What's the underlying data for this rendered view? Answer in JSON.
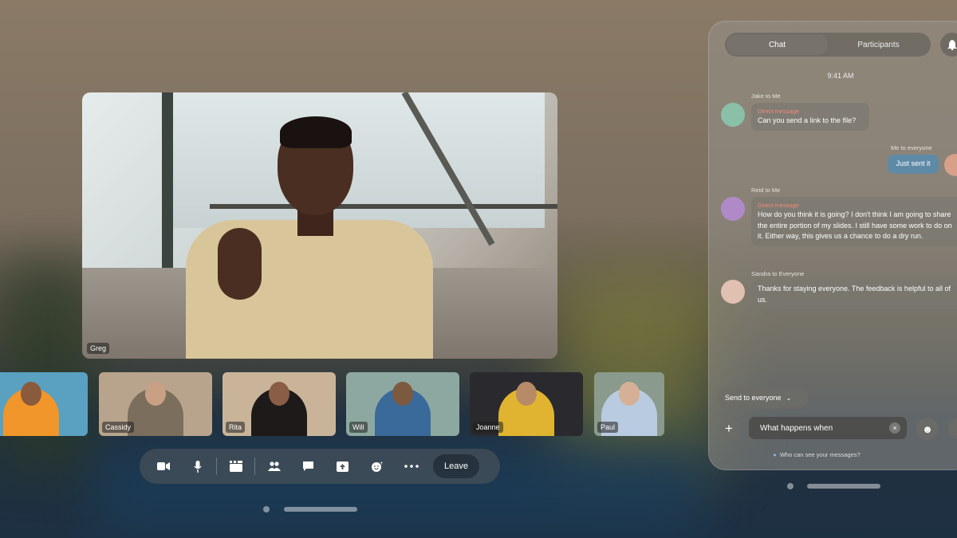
{
  "main_video": {
    "participant_name": "Greg"
  },
  "thumbnails": [
    {
      "name": "",
      "bg": "#5aa0c0",
      "shirt": "#f0962a",
      "skin": "#8a5a3c"
    },
    {
      "name": "Cassidy",
      "bg": "#b8a48c",
      "shirt": "#7b6e5c",
      "skin": "#c9a084"
    },
    {
      "name": "Rita",
      "bg": "#c9b49a",
      "shirt": "#1e1a1a",
      "skin": "#8a5e46"
    },
    {
      "name": "Will",
      "bg": "#8da8a0",
      "shirt": "#3a6a9a",
      "skin": "#7c5a40"
    },
    {
      "name": "Joanne",
      "bg": "#2a2a2e",
      "shirt": "#e0b430",
      "skin": "#b78a68"
    },
    {
      "name": "Paul",
      "bg": "#8a9a8c",
      "shirt": "#b9cbe0",
      "skin": "#d6b096"
    }
  ],
  "toolbar": {
    "icons": {
      "camera": "camera-icon",
      "mic": "microphone-icon",
      "clapper": "clapper-icon",
      "people": "participants-icon",
      "chat": "chat-icon",
      "share": "share-screen-icon",
      "react": "reaction-icon",
      "more": "more-icon"
    },
    "leave_label": "Leave"
  },
  "chat": {
    "tabs": [
      {
        "label": "Chat",
        "active": true
      },
      {
        "label": "Participants",
        "active": false
      }
    ],
    "time": "9:41 AM",
    "messages": [
      {
        "sender": "Jake to Me",
        "tag": "Direct message",
        "text": "Can you send a link to the file?",
        "mine": false,
        "avatar_color": "#8ac0a8"
      },
      {
        "sender": "Me to everyone",
        "tag": "",
        "text": "Just sent it",
        "mine": true,
        "avatar_color": "#d8a088"
      },
      {
        "sender": "Reid to Me",
        "tag": "Direct message",
        "text": "How do you think it is going? I don't think I am going to share the entire portion of my slides. I still have some work to do on it. Either way, this gives us a chance to do a dry run.",
        "mine": false,
        "avatar_color": "#b08ac8"
      },
      {
        "sender": "Sandra to Everyone",
        "tag": "",
        "text": "Thanks for staying everyone. The feedback is helpful to all of us.",
        "mine": false,
        "avatar_color": "#e0c0b0"
      }
    ],
    "send_to_label": "Send to everyone",
    "input_value": "What happens when",
    "input_placeholder": "Message",
    "who_can_see": "Who can see your messages?",
    "accent_color": "#5f8aa6",
    "dm_color": "#f0887a"
  }
}
